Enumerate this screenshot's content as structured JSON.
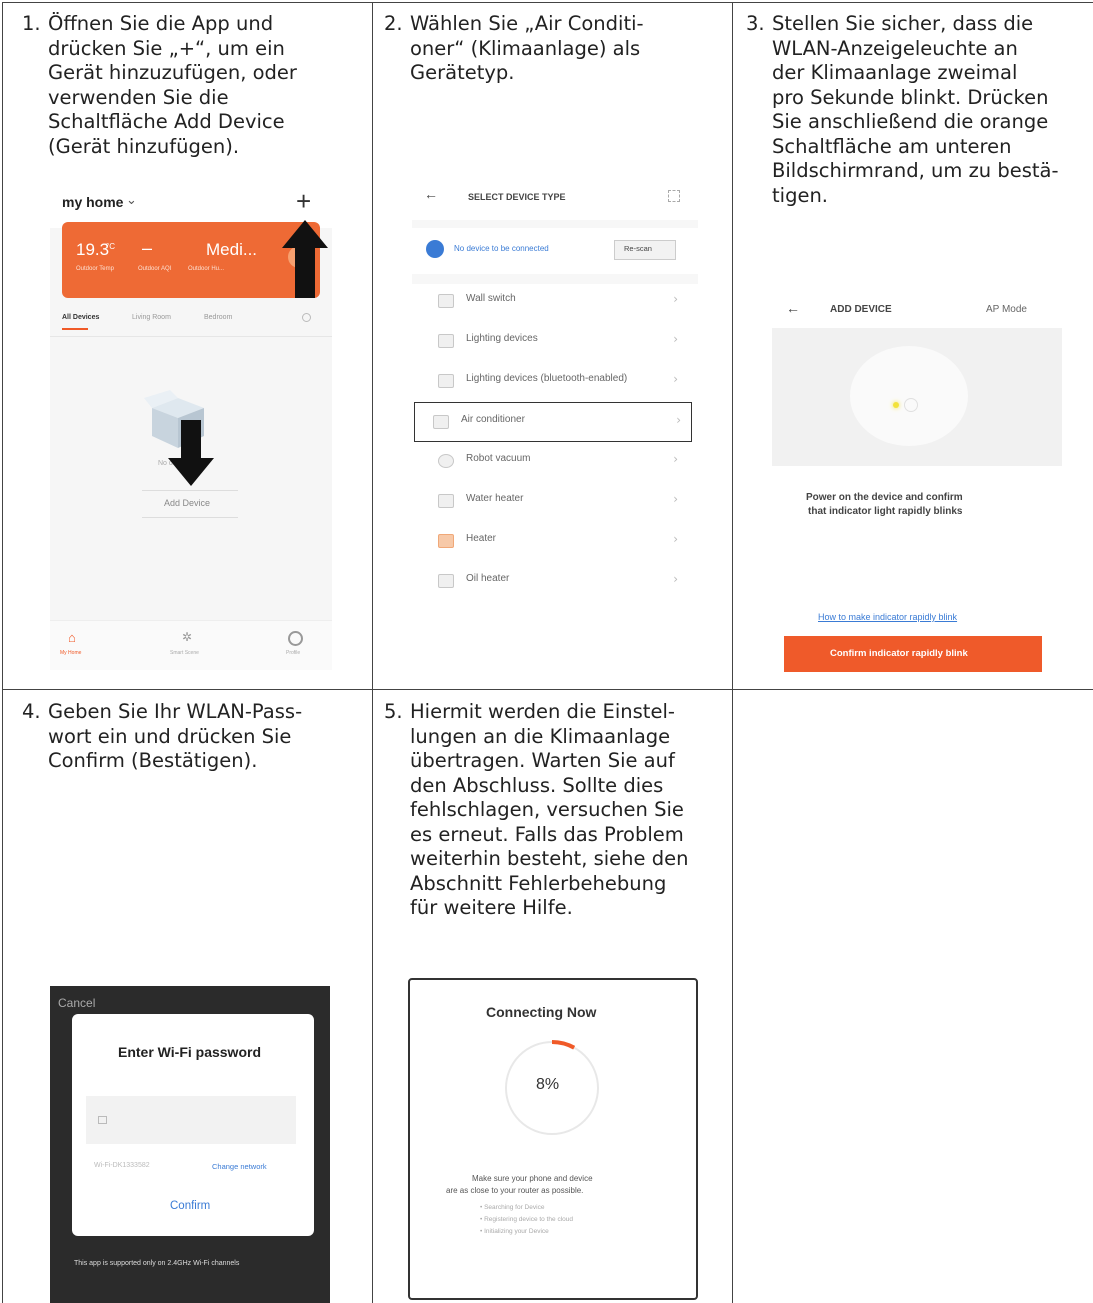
{
  "steps": [
    {
      "num": "1.",
      "text": "Öffnen Sie die App und\ndrücken Sie „+“, um ein\nGerät hinzuzufügen, oder\nverwenden Sie die\nSchaltfläche Add Device\n(Gerät hinzufügen)."
    },
    {
      "num": "2.",
      "text": "Wählen Sie „Air Conditi-\noner“ (Klimaanlage) als\nGerätetyp."
    },
    {
      "num": "3.",
      "text": "Stellen Sie sicher, dass die\nWLAN-Anzeigeleuchte an\nder Klimaanlage zweimal\npro Sekunde blinkt. Drücken\nSie anschließend die orange\nSchaltfläche am unteren\nBildschirmrand, um zu bestä-\ntigen."
    },
    {
      "num": "4.",
      "text": "Geben Sie Ihr WLAN-Pass-\nwort ein und drücken Sie\nConfirm (Bestätigen)."
    },
    {
      "num": "5.",
      "text": "Hiermit werden die Einstel-\nlungen an die Klimaanlage\nübertragen. Warten Sie auf\nden Abschluss. Sollte dies\nfehlschlagen, versuchen Sie\nes erneut. Falls das Problem\nweiterhin besteht, siehe den\nAbschnitt Fehlerbehebung\nfür weitere Hilfe."
    }
  ],
  "screen1": {
    "home_title": "my home",
    "temp": "19.3",
    "temp_unit": "°C",
    "dash": "–",
    "medium": "Medi...",
    "sub1": "Outdoor Temp",
    "sub2": "Outdoor AQI",
    "sub3": "Outdoor Hu...",
    "tabs": [
      "All Devices",
      "Living Room",
      "Bedroom"
    ],
    "no_devices": "No devices",
    "add_device": "Add Device",
    "nav": [
      "My Home",
      "Smart Scene",
      "Profile"
    ]
  },
  "screen2": {
    "title": "SELECT DEVICE TYPE",
    "notice": "No device to be connected",
    "rescan": "Re-scan",
    "items": [
      "Wall switch",
      "Lighting devices",
      "Lighting devices (bluetooth-enabled)",
      "Air conditioner",
      "Robot vacuum",
      "Water heater",
      "Heater",
      "Oil heater"
    ]
  },
  "screen3": {
    "title": "ADD DEVICE",
    "mode": "AP Mode",
    "instruction_1": "Power on the device and confirm",
    "instruction_2": "that indicator light rapidly blinks",
    "help_link": "How to make indicator rapidly blink",
    "confirm": "Confirm indicator rapidly blink"
  },
  "screen4": {
    "cancel": "Cancel",
    "title": "Enter Wi-Fi password",
    "network": "Wi-Fi-DK1333582",
    "change": "Change network",
    "confirm": "Confirm",
    "footer": "This app is supported only on 2.4GHz Wi-Fi channels"
  },
  "screen5": {
    "title": "Connecting Now",
    "progress_label": "8%",
    "progress": 0.08,
    "hint_1": "Make sure your phone and device",
    "hint_2": "are as close to your router as possible.",
    "status": [
      "Searching for Device",
      "Registering device to the cloud",
      "Initializing your Device"
    ]
  },
  "colors": {
    "accent": "#f05a28",
    "link": "#3a7bd5"
  }
}
